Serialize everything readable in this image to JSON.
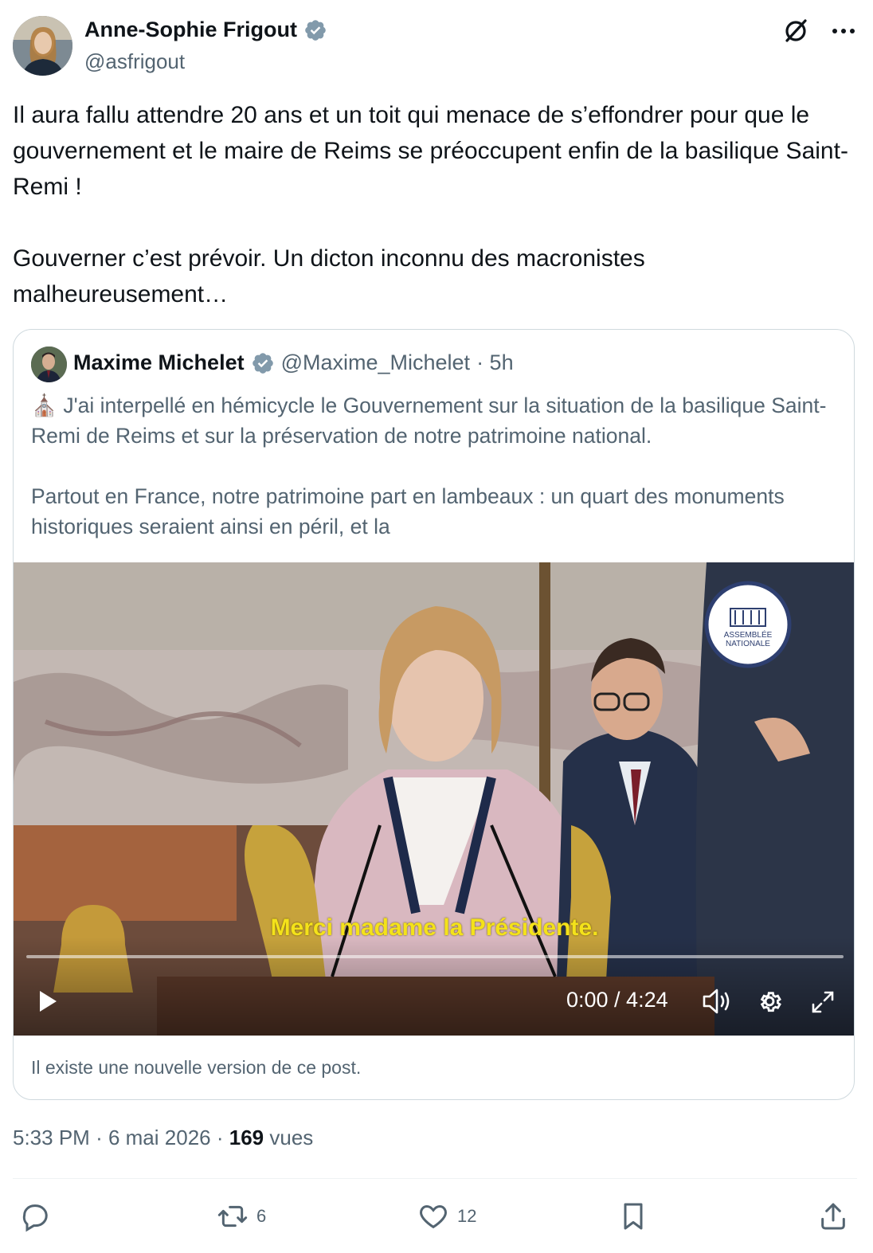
{
  "author": {
    "name": "Anne-Sophie Frigout",
    "handle": "@asfrigout"
  },
  "icons": {
    "verified": "verified-badge-icon",
    "grok": "grok-icon",
    "more": "more-icon",
    "reply": "reply-icon",
    "retweet": "retweet-icon",
    "like": "like-icon",
    "bookmark": "bookmark-icon",
    "share": "share-icon"
  },
  "post": {
    "text": "Il aura fallu attendre 20 ans et un toit qui menace de s’effondrer pour que le gouvernement et le maire de Reims se préoccupent enfin de la basilique Saint-Remi !\n\nGouverner c’est prévoir. Un dicton inconnu des macronistes malheureusement…"
  },
  "quote": {
    "name": "Maxime Michelet",
    "handle": "@Maxime_Michelet",
    "time": "· 5h",
    "emoji": "⛪",
    "text": " J'ai interpellé en hémicycle le Gouvernement sur la situation de la basilique Saint-Remi de Reims et sur la préservation de notre patrimoine national.\n\nPartout en France, notre patrimoine part en lambeaux : un quart des monuments historiques seraient ainsi en péril, et la",
    "video": {
      "subtitle": "Merci madame la Présidente.",
      "time": "0:00 / 4:24",
      "logo_line1": "ASSEMBLÉE",
      "logo_line2": "NATIONALE",
      "progress": 0
    },
    "footer": "Il existe une nouvelle version de ce post."
  },
  "meta": {
    "time": "5:33 PM",
    "sep1": "·",
    "date": "6 mai 2026",
    "sep2": "·",
    "views": "169",
    "views_label": "vues"
  },
  "actions": {
    "retweets": "6",
    "likes": "12"
  },
  "colors": {
    "verified": "#829aab",
    "text": "#0f1419",
    "secondary": "#536471",
    "border": "#cfd9de",
    "subtitle": "#f4e21a"
  }
}
